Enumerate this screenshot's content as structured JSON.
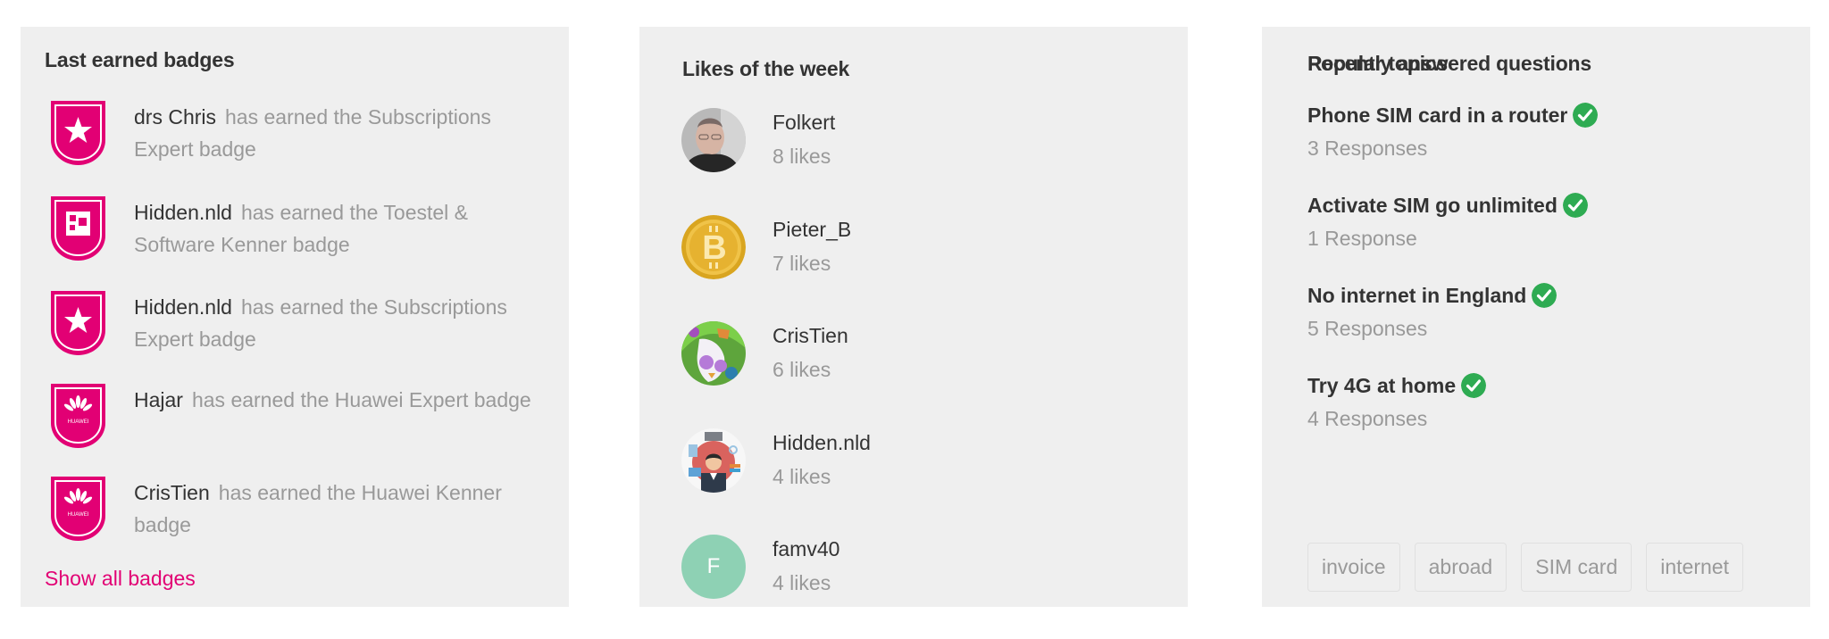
{
  "badges_panel": {
    "title": "Last earned badges",
    "items": [
      {
        "user": "drs Chris",
        "description": "has earned the Subscriptions Expert badge",
        "icon": "star-shield-icon"
      },
      {
        "user": "Hidden.nld",
        "description": "has earned the Toestel & Software Kenner badge",
        "icon": "puzzle-shield-icon"
      },
      {
        "user": "Hidden.nld",
        "description": "has earned the Subscriptions Expert badge",
        "icon": "star-shield-icon"
      },
      {
        "user": "Hajar",
        "description": "has earned the Huawei Expert badge",
        "icon": "huawei-shield-icon"
      },
      {
        "user": "CrisTien",
        "description": "has earned the Huawei Kenner badge",
        "icon": "huawei-shield-icon"
      }
    ],
    "huawei_label": "HUAWEI",
    "show_all_label": "Show all badges"
  },
  "likes_panel": {
    "title": "Likes of the week",
    "items": [
      {
        "name": "Folkert",
        "likes": "8 likes",
        "avatar": "photo-avatar"
      },
      {
        "name": "Pieter_B",
        "likes": "7 likes",
        "avatar": "bitcoin-avatar"
      },
      {
        "name": "CrisTien",
        "likes": "6 likes",
        "avatar": "illustration-avatar"
      },
      {
        "name": "Hidden.nld",
        "likes": "4 likes",
        "avatar": "office-worker-avatar"
      },
      {
        "name": "famv40",
        "likes": "4 likes",
        "avatar": "letter-avatar",
        "initial": "F"
      }
    ]
  },
  "questions_panel": {
    "title": "Recently answered questions",
    "items": [
      {
        "title": "Phone SIM card in a router",
        "responses": "3 Responses",
        "solved": true
      },
      {
        "title": "Activate SIM go unlimited",
        "responses": "1 Response",
        "solved": true
      },
      {
        "title": "No internet in England",
        "responses": "5 Responses",
        "solved": true
      },
      {
        "title": "Try 4G at home",
        "responses": "4 Responses",
        "solved": true
      }
    ],
    "topics_title": "Popular topics",
    "topics": [
      "invoice",
      "abroad",
      "SIM card",
      "internet"
    ]
  },
  "colors": {
    "brand": "#e20074",
    "panel_bg": "#efefef",
    "solved_green": "#2eab52",
    "letter_avatar": "#8ed1b4",
    "primary_text": "#333333",
    "secondary_text": "#999999"
  }
}
